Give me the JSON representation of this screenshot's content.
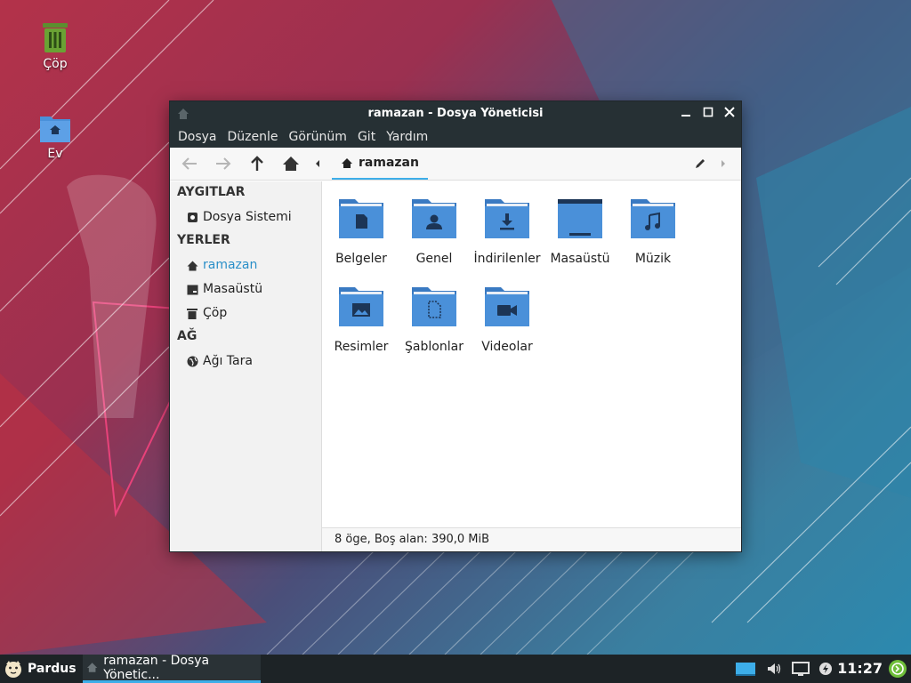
{
  "desktop": {
    "icons": [
      {
        "label": "Çöp"
      },
      {
        "label": "Ev"
      }
    ]
  },
  "window": {
    "title": "ramazan - Dosya Yöneticisi",
    "menu": [
      "Dosya",
      "Düzenle",
      "Görünüm",
      "Git",
      "Yardım"
    ],
    "breadcrumb": "ramazan",
    "sidebar": {
      "devices_header": "AYGITLAR",
      "devices": [
        "Dosya Sistemi"
      ],
      "places_header": "YERLER",
      "places": [
        "ramazan",
        "Masaüstü",
        "Çöp"
      ],
      "network_header": "AĞ",
      "network": [
        "Ağı Tara"
      ]
    },
    "folders": [
      "Belgeler",
      "Genel",
      "İndirilenler",
      "Masaüstü",
      "Müzik",
      "Resimler",
      "Şablonlar",
      "Videolar"
    ],
    "status": "8 öge, Boş alan: 390,0 MiB"
  },
  "taskbar": {
    "start_label": "Pardus",
    "task_label": "ramazan - Dosya Yönetic...",
    "clock": "11:27"
  },
  "colors": {
    "accent": "#3daee9",
    "folder": "#4a90d9",
    "titlebar": "#263034"
  }
}
